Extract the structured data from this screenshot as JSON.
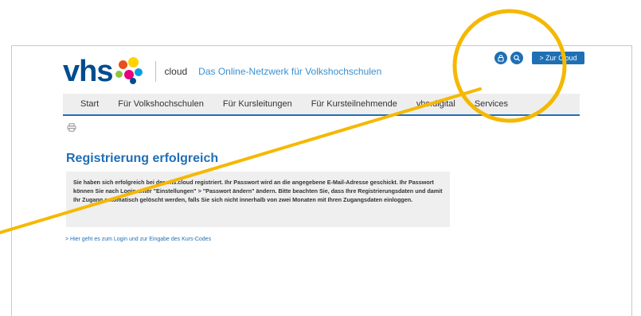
{
  "header": {
    "logo_text": "vhs",
    "product": "cloud",
    "tagline": "Das Online-Netzwerk für Volkshochschulen",
    "login_icon": "lock-icon",
    "search_icon": "search-icon",
    "cloud_button": "> Zur Cloud"
  },
  "nav": {
    "items": [
      "Start",
      "Für Volkshochschulen",
      "Für Kursleitungen",
      "Für Kursteilnehmende",
      "vhs.digital",
      "Services"
    ]
  },
  "toolbar": {
    "print_icon": "printer-icon"
  },
  "main": {
    "title": "Registrierung erfolgreich",
    "message": "Sie haben sich erfolgreich bei der vhs.cloud registriert. Ihr Passwort wird an die angegebene E-Mail-Adresse geschickt. Ihr Passwort können Sie nach Login unter \"Einstellungen\" > \"Passwort ändern\" ändern. Bitte beachten Sie, dass Ihre Registrierungsdaten und damit Ihr Zugang automatisch gelöscht werden, falls Sie sich nicht innerhalb von zwei Monaten mit Ihren Zugangsdaten einloggen.",
    "link": "> Hier geht es zum Login und zur Eingabe des Kurs-Codes"
  },
  "colors": {
    "brand_blue": "#1f6fb5",
    "logo_blue": "#004c8f",
    "highlight_yellow": "#f5b800"
  }
}
